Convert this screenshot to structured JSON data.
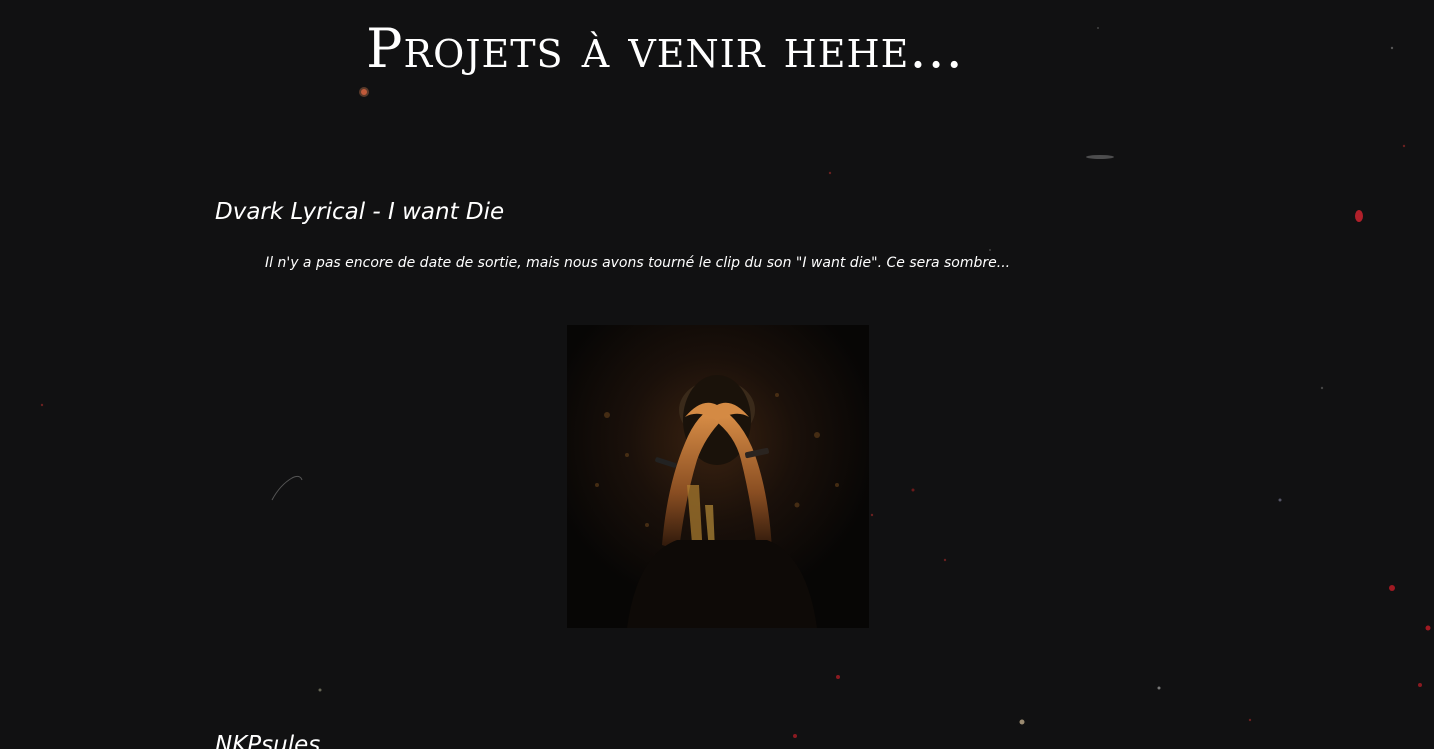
{
  "page": {
    "title": "Projets à venir hehe..."
  },
  "projects": [
    {
      "title": "Dvark Lyrical - I want Die",
      "description": "Il n'y a pas encore de date de sortie, mais nous avons tourné le clip du son \"I want die\". Ce sera sombre...",
      "image": "cover-photo-hands-on-head"
    },
    {
      "title": "NKPsules"
    }
  ],
  "colors": {
    "background": "#111112",
    "text": "#ffffff",
    "speck_red": "#c0202a",
    "photo_warm": "#c47a3a"
  }
}
